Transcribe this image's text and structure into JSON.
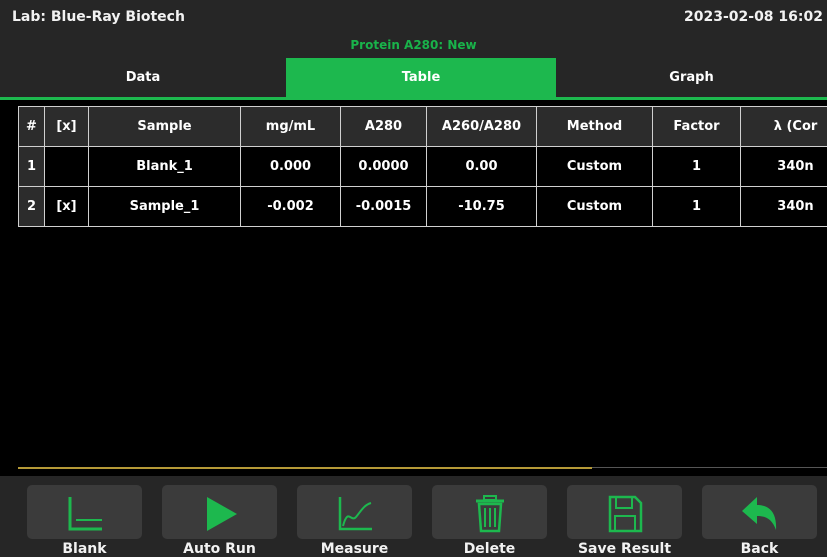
{
  "header": {
    "lab": "Lab: Blue-Ray Biotech",
    "datetime": "2023-02-08 16:02",
    "mode": "Protein A280: New"
  },
  "tabs": [
    {
      "label": "Data",
      "active": false
    },
    {
      "label": "Table",
      "active": true
    },
    {
      "label": "Graph",
      "active": false
    }
  ],
  "table": {
    "columns": [
      "#",
      "[x]",
      "Sample",
      "mg/mL",
      "A280",
      "A260/A280",
      "Method",
      "Factor",
      "λ (Cor"
    ],
    "rows": [
      [
        "1",
        "",
        "Blank_1",
        "0.000",
        "0.0000",
        "0.00",
        "Custom",
        "1",
        "340n"
      ],
      [
        "2",
        "[x]",
        "Sample_1",
        "-0.002",
        "-0.0015",
        "-10.75",
        "Custom",
        "1",
        "340n"
      ]
    ]
  },
  "toolbar": {
    "blank": "Blank",
    "auto_run": "Auto Run",
    "measure": "Measure",
    "delete": "Delete",
    "save_result": "Save Result",
    "back": "Back"
  },
  "colors": {
    "accent_green": "#1db84e",
    "header_bg": "#262626",
    "button_bg": "#3b3b3b",
    "scroll_indicator": "#b59a37"
  },
  "icons": {
    "blank": "blank-axis-icon",
    "auto_run": "play-icon",
    "measure": "measure-chart-icon",
    "delete": "trash-icon",
    "save_result": "floppy-disk-icon",
    "back": "back-arrow-icon"
  }
}
